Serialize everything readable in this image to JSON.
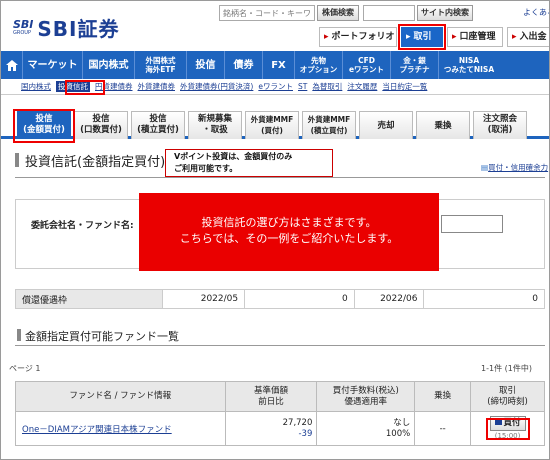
{
  "header": {
    "logo_mark": "SBI",
    "logo_sub": "GROUP",
    "logo_text": "SBI証券",
    "search_placeholder": "銘柄名・コード・キーワ",
    "stock_search": "株価検索",
    "site_search": "サイト内検索",
    "top_link": "よくある",
    "portfolio": "ポートフォリオ",
    "trade": "取引",
    "account": "口座管理",
    "deposit": "入出金"
  },
  "nav": {
    "items": [
      "マーケット",
      "国内株式",
      "外国株式\n海外ETF",
      "投信",
      "債券",
      "FX",
      "先物\nオプション",
      "CFD\neワラント",
      "金・銀\nプラチナ",
      "NISA\nつみたてNISA"
    ]
  },
  "subnav": {
    "items": [
      "国内株式",
      "投資信託",
      "円貨建債券",
      "外貨建債券",
      "外貨建債券(円貨決済)",
      "eワラント",
      "ST",
      "為替取引",
      "注文履歴",
      "当日約定一覧"
    ]
  },
  "tabs": [
    "投信\n(金額買付)",
    "投信\n(口数買付)",
    "投信\n(積立買付)",
    "新規募集\n・取扱",
    "外貨建MMF\n(買付)",
    "外貨建MMF\n(積立買付)",
    "売却",
    "乗換",
    "注文照会\n(取消)"
  ],
  "page_title": "投資信託(金額指定買付)",
  "title_link": "買付・信用確余力",
  "callout": "Vポイント投資は、金額買付のみ\nご利用可能です。",
  "search_box": {
    "label": "委託会社名・ファンド名:"
  },
  "banner": "投資信託の選び方はさまざまです。\nこちらでは、その一例をご紹介いたします。",
  "redemption_row": {
    "label": "償還優遇枠",
    "month1": "2022/05",
    "value1": "0",
    "month2": "2022/06",
    "value2": "0"
  },
  "section2_title": "金額指定買付可能ファンド一覧",
  "page_info": "ページ 1",
  "count_info": "1-1件 (1件中)",
  "fund_table": {
    "headers": [
      "ファンド名 / ファンド情報",
      "基準価額\n前日比",
      "買付手数料(税込)\n優遇適用率",
      "乗換",
      "取引\n(締切時刻)"
    ],
    "rows": [
      {
        "name": "One－DIAMアジア関連日本株ファンド",
        "price": "27,720",
        "change": "-39",
        "fee": "なし",
        "rate": "100%",
        "switch": "--",
        "buy": "買付",
        "cutoff": "(15:00)"
      }
    ]
  },
  "colors": {
    "brand_blue": "#1e64be",
    "highlight_red": "#ea0000"
  }
}
